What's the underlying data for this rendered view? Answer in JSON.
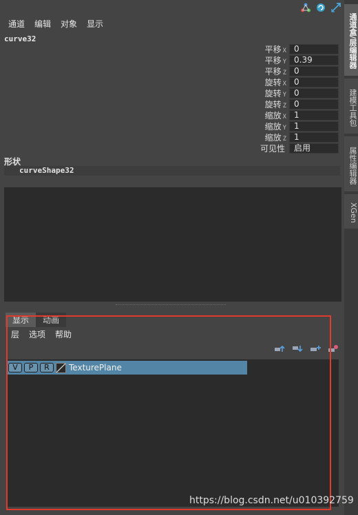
{
  "top_icons": [
    "triangle-axis-icon",
    "circle-arrow-icon",
    "diagonal-arrow-icon"
  ],
  "menubar": {
    "items": [
      "通道",
      "编辑",
      "对象",
      "显示"
    ]
  },
  "object_name": "curve32",
  "attributes": [
    {
      "label": "平移",
      "axis": "X",
      "value": "0"
    },
    {
      "label": "平移",
      "axis": "Y",
      "value": "0.39"
    },
    {
      "label": "平移",
      "axis": "Z",
      "value": "0"
    },
    {
      "label": "旋转",
      "axis": "X",
      "value": "0"
    },
    {
      "label": "旋转",
      "axis": "Y",
      "value": "0"
    },
    {
      "label": "旋转",
      "axis": "Z",
      "value": "0"
    },
    {
      "label": "缩放",
      "axis": "X",
      "value": "1"
    },
    {
      "label": "缩放",
      "axis": "Y",
      "value": "1"
    },
    {
      "label": "缩放",
      "axis": "Z",
      "value": "1"
    },
    {
      "label": "可见性",
      "axis": "",
      "value": "启用"
    }
  ],
  "shapes": {
    "title": "形状",
    "items": [
      "curveShape32"
    ]
  },
  "layer_editor": {
    "tabs": [
      "显示",
      "动画"
    ],
    "active_tab": "显示",
    "menu": [
      "层",
      "选项",
      "帮助"
    ],
    "toolbar_icons": [
      "move-layer-up-icon",
      "move-layer-down-icon",
      "new-layer-icon",
      "new-layer-from-selected-icon"
    ],
    "layers": [
      {
        "v": "V",
        "p": "P",
        "r": "R",
        "name": "TexturePlane",
        "selected": true
      }
    ]
  },
  "right_tabs": [
    "通道盒/层编辑器",
    "建模工具包",
    "属性编辑器",
    "XGen"
  ],
  "watermark": "https://blog.csdn.net/u010392759",
  "colors": {
    "background": "#444444",
    "panel_dark": "#2b2b2b",
    "selected_layer": "#5285a6",
    "highlight_box": "#e23a2c"
  }
}
